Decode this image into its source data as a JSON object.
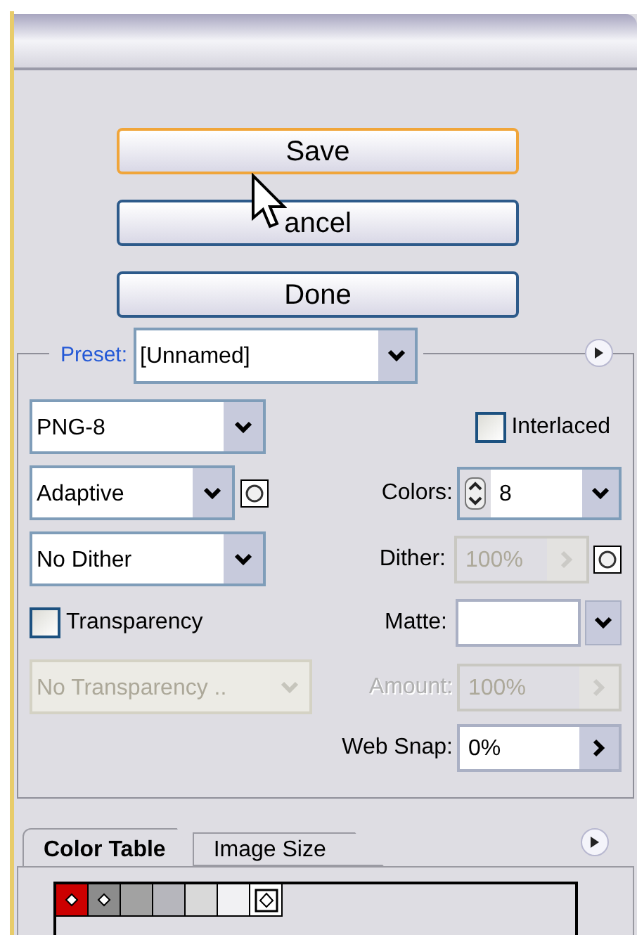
{
  "buttons": [
    {
      "label": "Save",
      "focused": true
    },
    {
      "label": "ancel",
      "focused": false
    },
    {
      "label": "Done",
      "focused": false
    }
  ],
  "preset": {
    "label": "Preset:",
    "value": "[Unnamed]"
  },
  "format": {
    "value": "PNG-8"
  },
  "interlaced": {
    "label": "Interlaced",
    "checked": false
  },
  "reduction": {
    "value": "Adaptive"
  },
  "colors": {
    "label": "Colors:",
    "value": "8"
  },
  "dither_algorithm": {
    "value": "No Dither"
  },
  "dither": {
    "label": "Dither:",
    "value": "100%",
    "disabled": true
  },
  "transparency": {
    "label": "Transparency",
    "checked": false
  },
  "matte": {
    "label": "Matte:"
  },
  "transparency_dither": {
    "value": "No Transparency ..",
    "disabled": true
  },
  "amount": {
    "label": "Amount:",
    "value": "100%",
    "disabled": true
  },
  "web_snap": {
    "label": "Web Snap:",
    "value": "0%"
  },
  "tabs": [
    {
      "label": "Color Table",
      "selected": true
    },
    {
      "label": "Image Size",
      "selected": false
    }
  ],
  "color_table": [
    {
      "color": "#cc0000",
      "kind": "marked"
    },
    {
      "color": "#8c8c8c",
      "kind": "marked"
    },
    {
      "color": "#a2a2a2",
      "kind": "plain"
    },
    {
      "color": "#b6b6bc",
      "kind": "plain"
    },
    {
      "color": "#d9d9d9",
      "kind": "plain"
    },
    {
      "color": "#f1f1f3",
      "kind": "plain"
    },
    {
      "color": "#ffffff",
      "kind": "boxed"
    }
  ]
}
